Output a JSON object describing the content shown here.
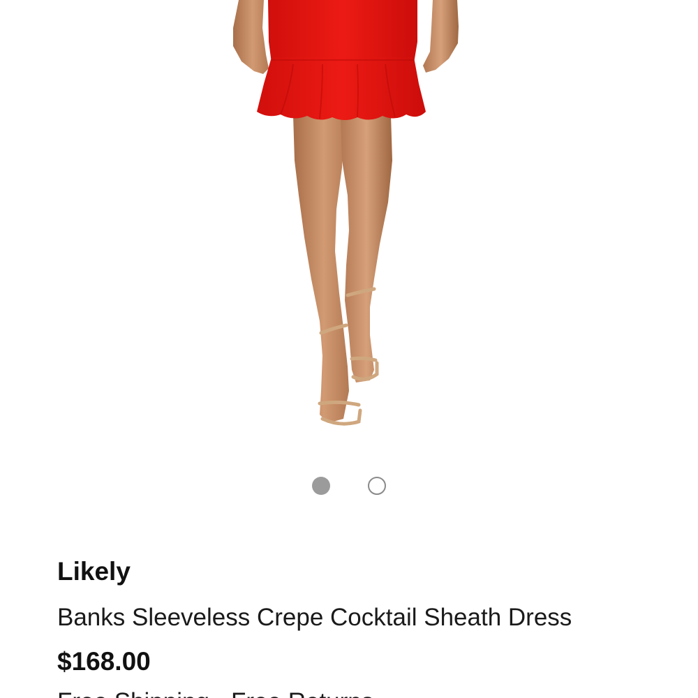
{
  "product": {
    "brand": "Likely",
    "name": "Banks Sleeveless Crepe Cocktail Sheath Dress",
    "price": "$168.00",
    "shipping_note": "Free Shipping · Free Returns"
  },
  "carousel": {
    "total_images": 2,
    "active_index": 0
  },
  "colors": {
    "dress": "#e3140f",
    "dot_active": "#9b9b9b",
    "dot_border": "#8a8a8a"
  }
}
